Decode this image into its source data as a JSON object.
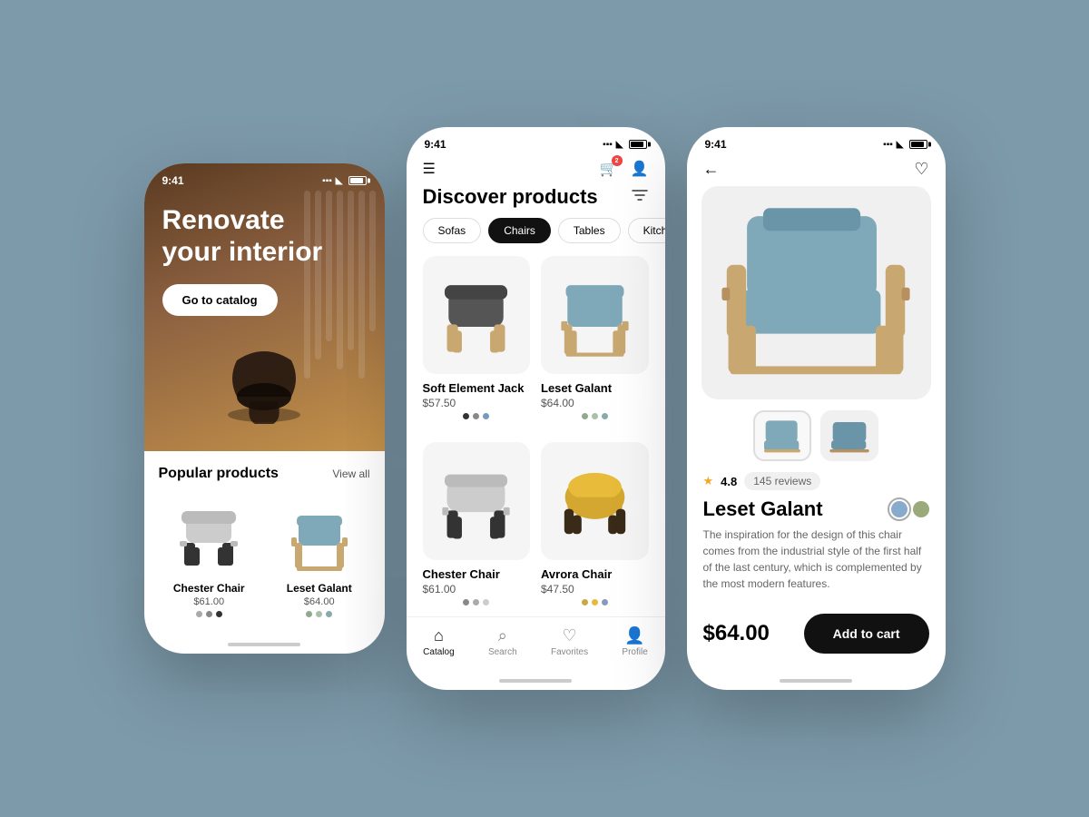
{
  "background": "#7d9aaa",
  "phone1": {
    "status_time": "9:41",
    "hero": {
      "title": "Renovate\nyour interior",
      "cta": "Go to catalog"
    },
    "popular": {
      "section_title": "Popular products",
      "view_all": "View all",
      "products": [
        {
          "name": "Chester Chair",
          "price": "$61.00",
          "colors": [
            "#aaa",
            "#888",
            "#333"
          ]
        },
        {
          "name": "Leset Galant",
          "price": "$64.00",
          "colors": [
            "#8faa8f",
            "#aabfaa",
            "#88aaaa"
          ]
        }
      ]
    }
  },
  "phone2": {
    "status_time": "9:41",
    "page_title": "Discover products",
    "categories": [
      "Sofas",
      "Chairs",
      "Tables",
      "Kitchen"
    ],
    "active_category": "Chairs",
    "cart_badge": "2",
    "products": [
      {
        "name": "Soft Element Jack",
        "price": "$57.50",
        "colors": [
          "#333",
          "#888",
          "#7799bb"
        ]
      },
      {
        "name": "Leset Galant",
        "price": "$64.00",
        "colors": [
          "#8faa8f",
          "#aabfaa",
          "#88aaaa"
        ]
      },
      {
        "name": "Chester Chair",
        "price": "$61.00",
        "colors": [
          "#888",
          "#aaa",
          "#ccc"
        ]
      },
      {
        "name": "Avrora Chair",
        "price": "$47.50",
        "colors": [
          "#c8a840",
          "#e8b840",
          "#8899bb"
        ]
      }
    ],
    "bottom_nav": [
      "Catalog",
      "Search",
      "Favorites",
      "Profile"
    ],
    "active_nav": "Catalog"
  },
  "phone3": {
    "status_time": "9:41",
    "product": {
      "name": "Leset Galant",
      "price": "$64.00",
      "rating": "4.8",
      "reviews": "145 reviews",
      "description": "The inspiration for the design of this chair comes from the industrial style of the first half of the last century, which is complemented by the most modern features.",
      "colors": [
        "#88aacc",
        "#9aaa7a"
      ]
    },
    "add_to_cart": "Add to cart"
  }
}
